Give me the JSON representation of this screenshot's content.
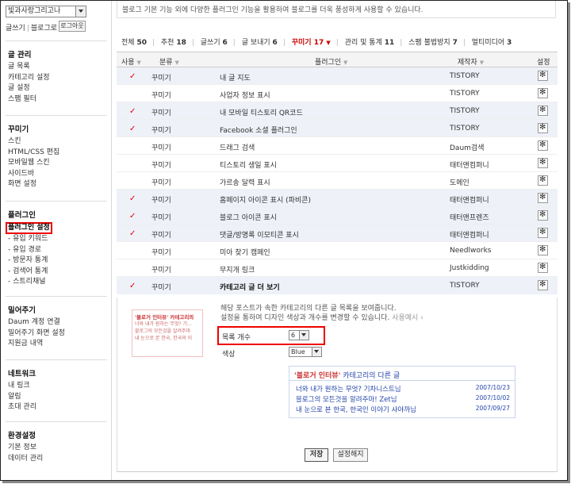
{
  "sidebar": {
    "blog_selector": "빛과사랑그리고나",
    "top_links": [
      "글쓰기",
      "블로그로"
    ],
    "logout": "로그아웃",
    "groups": [
      {
        "title": "글 관리",
        "items": [
          "글 목록",
          "카테고리 설정",
          "글 설정",
          "스팸 필터"
        ]
      },
      {
        "title": "꾸미기",
        "items": [
          "스킨",
          "HTML/CSS 편집",
          "모바일웹 스킨",
          "사이드바",
          "화면 설정"
        ]
      },
      {
        "title": "플러그인",
        "items": [
          "플러그인 설정",
          "- 유입 키워드",
          "- 유입 경로",
          "- 방문자 통계",
          "- 검색어 통계",
          "- 스트리채널"
        ]
      },
      {
        "title": "밀어주기",
        "items": [
          "Daum 계정 연결",
          "밀어주기 화면 설정",
          "지원금 내역"
        ]
      },
      {
        "title": "네트워크",
        "items": [
          "내 링크",
          "알림",
          "초대 관리"
        ]
      },
      {
        "title": "환경설정",
        "items": [
          "기본 정보",
          "데이터 관리"
        ]
      }
    ]
  },
  "main": {
    "description": "블로그 기본 기능 외에 다양한 플러그인 기능을 활용하여 블로그를 더욱 풍성하게 사용할 수 있습니다.",
    "filters": [
      {
        "label": "전체",
        "count": "50"
      },
      {
        "label": "추천",
        "count": "18"
      },
      {
        "label": "글쓰기",
        "count": "6"
      },
      {
        "label": "글 보내기",
        "count": "6"
      },
      {
        "label": "꾸미기",
        "count": "17"
      },
      {
        "label": "관리 및 통계",
        "count": "11"
      },
      {
        "label": "스팸 불법방지",
        "count": "7"
      },
      {
        "label": "멀티미디어",
        "count": "3"
      }
    ],
    "headers": {
      "use": "사용",
      "category": "분류",
      "plugin": "플러그인",
      "maker": "제작자",
      "settings": "설정"
    },
    "rows": [
      {
        "checked": true,
        "check": "✓",
        "category": "꾸미기",
        "name": "내 글 지도",
        "maker": "TISTORY"
      },
      {
        "checked": false,
        "check": "",
        "category": "꾸미기",
        "name": "사업자 정보 표시",
        "maker": "TISTORY"
      },
      {
        "checked": true,
        "check": "✓",
        "category": "꾸미기",
        "name": "내 모바일 티스토리 QR코드",
        "maker": "TISTORY"
      },
      {
        "checked": true,
        "check": "✓",
        "category": "꾸미기",
        "name": "Facebook 소셜 플러그인",
        "maker": "TISTORY"
      },
      {
        "checked": false,
        "check": "",
        "category": "꾸미기",
        "name": "드래그 검색",
        "maker": "Daum검색"
      },
      {
        "checked": false,
        "check": "",
        "category": "꾸미기",
        "name": "티스토리 생일 표시",
        "maker": "태터앤컴퍼니"
      },
      {
        "checked": false,
        "check": "",
        "category": "꾸미기",
        "name": "가르송 달력 표시",
        "maker": "도메인"
      },
      {
        "checked": true,
        "check": "✓",
        "category": "꾸미기",
        "name": "홈페이지 아이콘 표시 (파비콘)",
        "maker": "태터앤컴퍼니"
      },
      {
        "checked": true,
        "check": "✓",
        "category": "꾸미기",
        "name": "블로그 아이콘 표시",
        "maker": "태터앤프렌즈"
      },
      {
        "checked": true,
        "check": "✓",
        "category": "꾸미기",
        "name": "댓글/방명록 이모티콘 표시",
        "maker": "태터앤컴퍼니"
      },
      {
        "checked": false,
        "check": "",
        "category": "꾸미기",
        "name": "미아 찾기 캠페인",
        "maker": "Needlworks"
      },
      {
        "checked": false,
        "check": "",
        "category": "꾸미기",
        "name": "무지개 링크",
        "maker": "Justkidding"
      },
      {
        "checked": true,
        "check": "✓",
        "category": "꾸미기",
        "name": "카테고리 글 더 보기",
        "maker": "TISTORY"
      }
    ],
    "detail": {
      "description_line1": "해당 포스트가 속한 카테고리의 다른 글 목록을 보여줍니다.",
      "description_line2": "설정을 통하여 디자인 색상과 개수를 변경할 수 있습니다.",
      "example_link": "사용예시",
      "thumb_title": "'블로거 인터뷰' 카테고리의",
      "thumb_lines": [
        "너와 내가 원하는 무엇? 기...",
        "블로그의 모든것을 알려주마",
        "내 눈으로 본 한국, 한국의 이"
      ],
      "count_label": "목록 개수",
      "count_value": "6",
      "color_label": "색상",
      "color_value": "Blue",
      "preview_title_bold": "'블로거 인터뷰'",
      "preview_title_rest": " 카테고리의 다른 글",
      "preview_items": [
        {
          "title": "너와 내가 원하는 무엇? 기차니스트님",
          "date": "2007/10/23"
        },
        {
          "title": "블로그의 모든것을 알려주마! Zet님",
          "date": "2007/10/02"
        },
        {
          "title": "내 눈으로 본 한국, 한국인 이야기 샤야까님",
          "date": "2007/09/27"
        }
      ],
      "save": "저장",
      "cancel": "설정해지"
    }
  },
  "colors": {
    "accent_red": "#e00000",
    "check_red": "#d00000",
    "link_blue": "#2244aa",
    "row_highlight": "#eef1f8"
  },
  "icons": {
    "check": "check-icon",
    "gear": "gear-icon",
    "dropdown": "chevron-down-icon"
  }
}
